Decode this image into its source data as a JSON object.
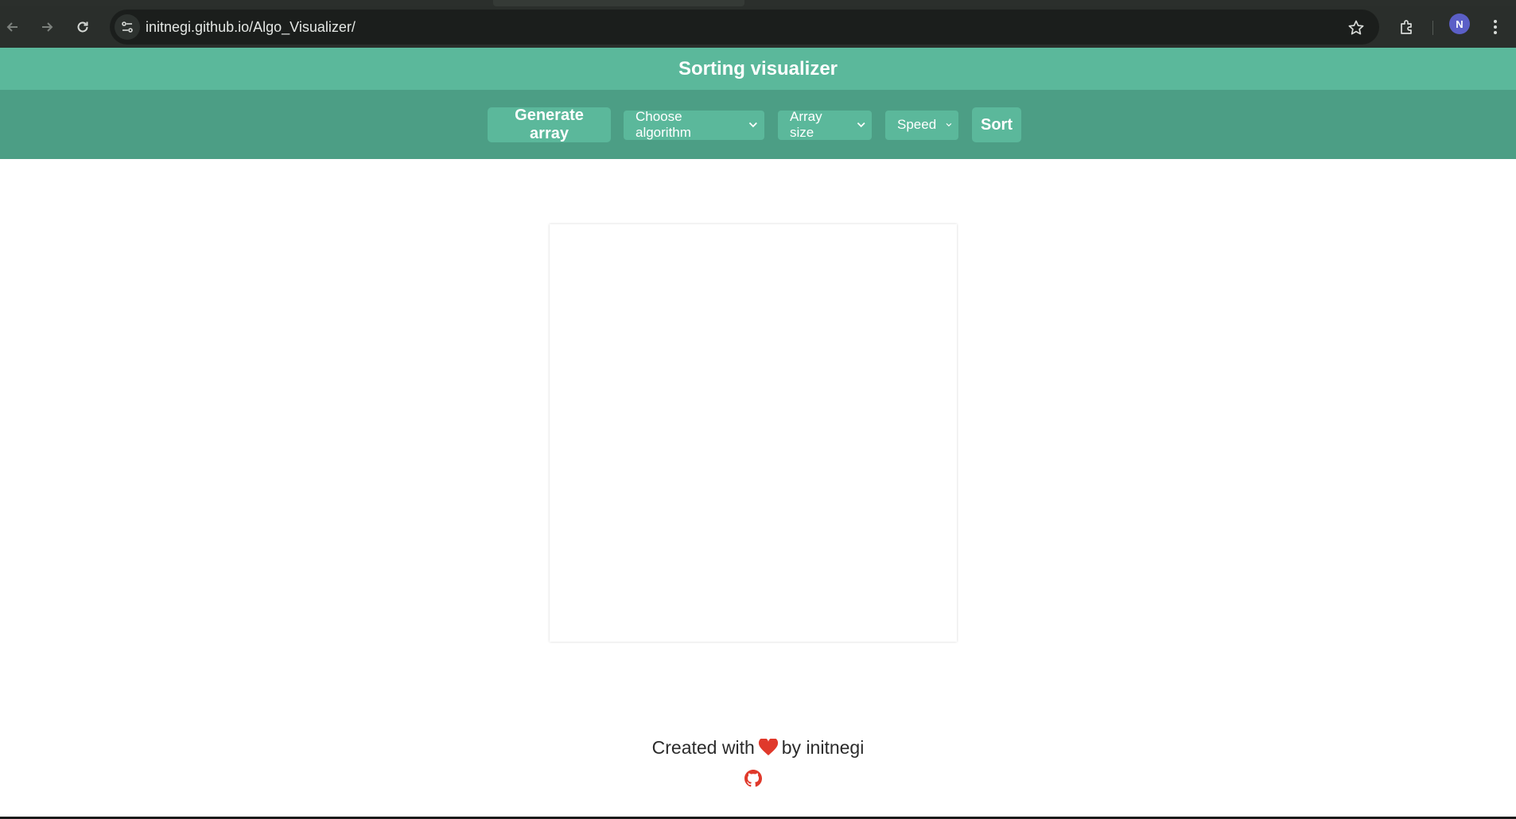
{
  "browser": {
    "url": "initnegi.github.io/Algo_Visualizer/",
    "profile_initial": "N"
  },
  "app": {
    "title": "Sorting visualizer"
  },
  "controls": {
    "generate_label": "Generate array",
    "algorithm_label": "Choose algorithm",
    "array_size_label": "Array size",
    "speed_label": "Speed",
    "sort_label": "Sort"
  },
  "footer": {
    "prefix": "Created with",
    "suffix": "by initnegi"
  },
  "colors": {
    "header": "#5bb89b",
    "control_bar": "#4c9e85",
    "heart": "#e0392b",
    "github": "#e0392b"
  },
  "icons": [
    "back-arrow-icon",
    "forward-arrow-icon",
    "reload-icon",
    "site-info-icon",
    "star-icon",
    "extensions-icon",
    "kebab-menu-icon",
    "chevron-down-icon",
    "heart-icon",
    "github-icon"
  ]
}
